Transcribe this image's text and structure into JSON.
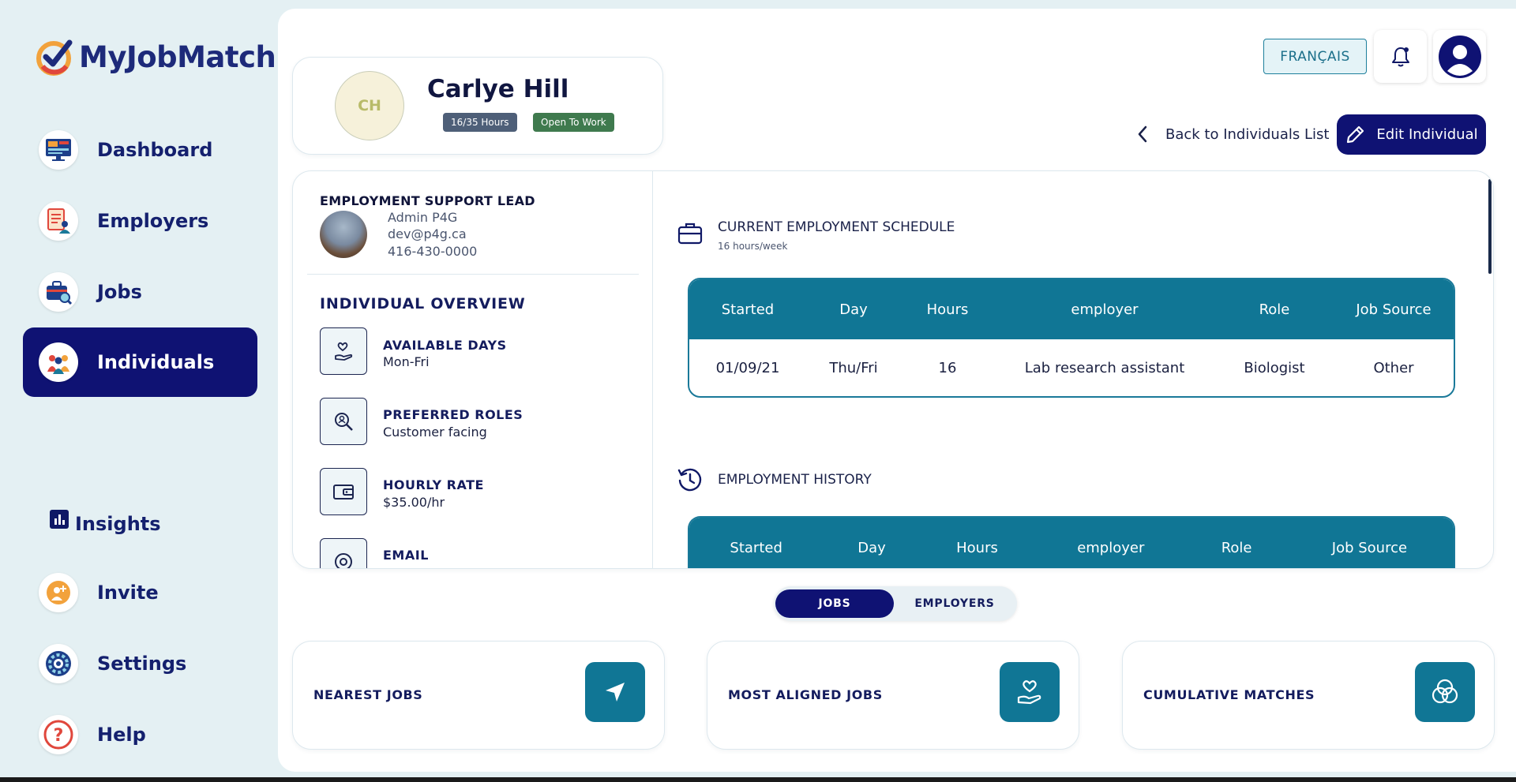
{
  "app": {
    "name": "MyJobMatch"
  },
  "sidebar": {
    "items": [
      {
        "label": "Dashboard",
        "icon": "dashboard-icon"
      },
      {
        "label": "Employers",
        "icon": "employers-icon"
      },
      {
        "label": "Jobs",
        "icon": "jobs-icon"
      },
      {
        "label": "Individuals",
        "icon": "individuals-icon",
        "active": true
      },
      {
        "label": "Insights",
        "icon": "insights-icon"
      },
      {
        "label": "Invite",
        "icon": "invite-icon"
      },
      {
        "label": "Settings",
        "icon": "settings-icon"
      },
      {
        "label": "Help",
        "icon": "help-icon"
      }
    ]
  },
  "header": {
    "language_button": "FRANÇAIS",
    "back_link": "Back to Individuals List",
    "edit_button": "Edit Individual"
  },
  "profile": {
    "initials": "CH",
    "name": "Carlye Hill",
    "hours_badge": "16/35 Hours",
    "status_badge": "Open To Work"
  },
  "support_lead": {
    "title": "EMPLOYMENT SUPPORT LEAD",
    "name": "Admin P4G",
    "email": "dev@p4g.ca",
    "phone": "416-430-0000"
  },
  "overview": {
    "title": "INDIVIDUAL OVERVIEW",
    "items": [
      {
        "label": "AVAILABLE DAYS",
        "value": "Mon-Fri",
        "icon": "hand-heart-icon"
      },
      {
        "label": "PREFERRED ROLES",
        "value": "Customer facing",
        "icon": "search-person-icon"
      },
      {
        "label": "HOURLY RATE",
        "value": "$35.00/hr",
        "icon": "wallet-icon"
      },
      {
        "label": "EMAIL",
        "value": "",
        "icon": "at-sign-icon"
      }
    ]
  },
  "current_schedule": {
    "title": "CURRENT EMPLOYMENT SCHEDULE",
    "subtitle": "16 hours/week",
    "columns": [
      "Started",
      "Day",
      "Hours",
      "employer",
      "Role",
      "Job Source"
    ],
    "rows": [
      [
        "01/09/21",
        "Thu/Fri",
        "16",
        "Lab research assistant",
        "Biologist",
        "Other"
      ]
    ]
  },
  "history": {
    "title": "EMPLOYMENT HISTORY",
    "columns": [
      "Started",
      "Day",
      "Hours",
      "employer",
      "Role",
      "Job Source"
    ]
  },
  "toggle": {
    "options": [
      "JOBS",
      "EMPLOYERS"
    ],
    "selected": "JOBS"
  },
  "match_cards": [
    {
      "label": "NEAREST JOBS",
      "icon": "navigation-arrow-icon"
    },
    {
      "label": "MOST ALIGNED JOBS",
      "icon": "hand-heart-icon"
    },
    {
      "label": "CUMULATIVE MATCHES",
      "icon": "venn-circles-icon"
    }
  ],
  "colors": {
    "primary": "#0f1273",
    "accent": "#107695",
    "background": "#e4f0f3",
    "badge_hours": "#4e5f78",
    "badge_open": "#3f7a4e"
  }
}
